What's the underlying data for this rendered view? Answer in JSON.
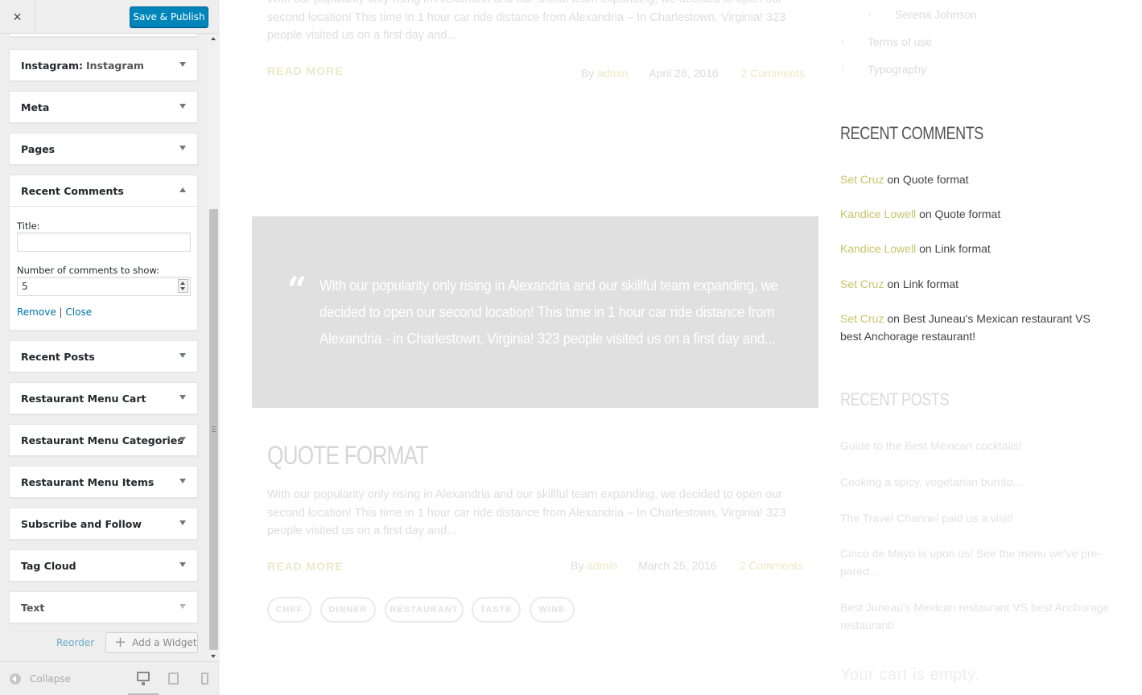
{
  "sidebar": {
    "close_icon": "×",
    "publish_label": "Save & Publish",
    "widgets": [
      {
        "title": "Instagram:",
        "subtitle": "Instagram"
      },
      {
        "title": "Meta"
      },
      {
        "title": "Pages"
      },
      {
        "title": "Recent Comments"
      },
      {
        "title": "Recent Posts"
      },
      {
        "title": "Restaurant Menu Cart"
      },
      {
        "title": "Restaurant Menu Categories"
      },
      {
        "title": "Restaurant Menu Items"
      },
      {
        "title": "Subscribe and Follow"
      },
      {
        "title": "Tag Cloud"
      },
      {
        "title": "Text"
      }
    ],
    "recent_comments_form": {
      "title_label": "Title:",
      "title_value": "",
      "count_label": "Number of comments to show:",
      "count_value": "5",
      "remove_label": "Remove",
      "separator": "|",
      "close_label": "Close"
    },
    "reorder_label": "Reorder",
    "add_widget_label": "Add a Widget",
    "add_widget_icon": "+",
    "collapse_label": "Collapse"
  },
  "preview": {
    "excerpt_top": "With our popularity only rising in Alexandria and our skillful team expanding, we decided to open our second location! This time in 1 hour car ride distance from Alexandria – In Charlestown, Virginia! 323 people visited us on a first day and...",
    "read_more": "READ MORE",
    "post1_meta": {
      "by": "By",
      "author": "admin",
      "date": "April 26, 2016",
      "comments": "2 Comments"
    },
    "quote_mark": "“",
    "quote_text": "With our popularity only rising in Alexandria and our skillful team expanding, we decided to open our second location! This time in 1 hour car ride distance from Alexandria - in Charlestown, Virginia! 323 people visited us on a first day and...",
    "post2_title": "QUOTE FORMAT",
    "post2_excerpt": "With our popularity only rising in Alexandria and our skillful team expanding, we decided to open our second location! This time in 1 hour car ride distance from Alexandria – In Charlestown, Virginia! 323 people visited us on a first day and...",
    "post2_meta": {
      "by": "By",
      "author": "admin",
      "date": "March 25, 2016",
      "comments": "2 Comments"
    },
    "tags": [
      "CHEF",
      "DINNER",
      "RESTAURANT",
      "TASTE",
      "WINE"
    ],
    "sidebar_pages": [
      "Serena Johnson",
      "Terms of use",
      "Typography"
    ],
    "recent_comments_heading": "RECENT COMMENTS",
    "recent_comments": [
      {
        "author": "Set Cruz",
        "on": "on",
        "post": "Quote format"
      },
      {
        "author": "Kandice Lowell",
        "on": "on",
        "post": "Quote format"
      },
      {
        "author": "Kandice Lowell",
        "on": "on",
        "post": "Link format"
      },
      {
        "author": "Set Cruz",
        "on": "on",
        "post": "Link format"
      },
      {
        "author": "Set Cruz",
        "on": "on",
        "post": "Best Juneau's Mexican restaurant VS best Anchorage restaurant!"
      }
    ],
    "recent_posts_heading": "RECENT POSTS",
    "recent_posts": [
      "Guide to the Best Mexican cocktails!",
      "Cooking a spicy, vegetarian burrito...",
      "The Travel Channel paid us a visit!",
      "Cinco de Mayo is upon us! See the menu we've pre-pared...",
      "Best Juneau's Mexican restaurant VS best Anchorage restaurant!"
    ],
    "cart_empty": "Your cart is empty."
  }
}
